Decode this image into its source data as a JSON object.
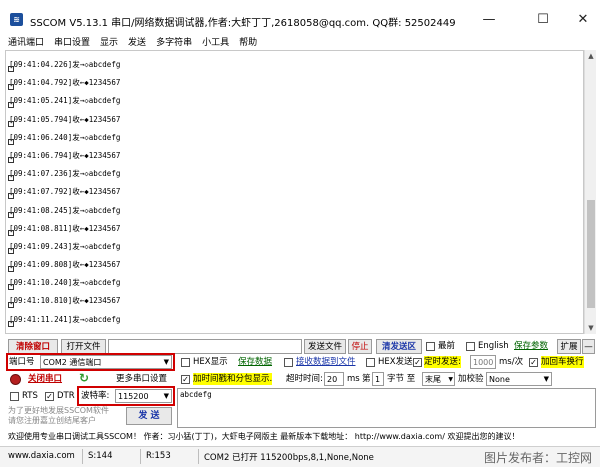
{
  "window": {
    "title": "SSCOM V5.13.1 串口/网络数据调试器,作者:大虾丁丁,2618058@qq.com. QQ群: 52502449",
    "minimize": "—",
    "maximize": "☐",
    "close": "✕"
  },
  "menu": [
    "通讯端口",
    "串口设置",
    "显示",
    "发送",
    "多字符串",
    "小工具",
    "帮助"
  ],
  "log": [
    "[09:41:04.226]发→◇abcdefg",
    "[09:41:04.792]收←◆1234567",
    "[09:41:05.241]发→◇abcdefg",
    "[09:41:05.794]收←◆1234567",
    "[09:41:06.240]发→◇abcdefg",
    "[09:41:06.794]收←◆1234567",
    "[09:41:07.236]发→◇abcdefg",
    "[09:41:07.792]收←◆1234567",
    "[09:41:08.245]发→◇abcdefg",
    "[09:41:08.811]收←◆1234567",
    "[09:41:09.243]发→◇abcdefg",
    "[09:41:09.808]收←◆1234567",
    "[09:41:10.240]发→◇abcdefg",
    "[09:41:10.810]收←◆1234567",
    "[09:41:11.241]发→◇abcdefg"
  ],
  "toolbar": {
    "clear_window": "清除窗口",
    "open_file": "打开文件",
    "send_file": "发送文件",
    "stop": "停止",
    "clear_send": "清发送区",
    "topmost": "最前",
    "english": "English",
    "save_params": "保存参数",
    "expand": "扩展",
    "collapse": "—"
  },
  "port": {
    "label": "端口号",
    "value": "COM2 通信端口",
    "open_port": "关闭串口",
    "more_settings": "更多串口设置",
    "rts": "RTS",
    "dtr": "DTR",
    "baud_label": "波特率:",
    "baud_value": "115200",
    "tip": "为了更好地发展SSCOM软件\n请您注册嘉立创结尾客户",
    "send": "发 送"
  },
  "options": {
    "hex_display": "HEX显示",
    "save_data": "保存数据",
    "recv_to_file": "接收数据到文件",
    "hex_send": "HEX发送",
    "timed_send": "定时发送:",
    "interval": "1000",
    "interval_unit": "ms/次",
    "add_newline": "加回车换行",
    "add_timestamp": "加时间戳和分包显示.",
    "timeout_label": "超时时间:",
    "timeout_value": "20",
    "timeout_unit": "ms",
    "byte_label_pre": "第",
    "byte_value": "1",
    "byte_label_post": "字节 至",
    "end_value": "末尾",
    "checksum_label": "加校验",
    "checksum_value": "None"
  },
  "send_area": {
    "text": "abcdefg"
  },
  "banner": "欢迎使用专业串口调试工具SSCOM！  作者：习小猛(丁丁)，大虾电子网版主  最新版本下载地址： http://www.daxia.com/  欢迎提出您的建议！",
  "status": {
    "site": "www.daxia.com",
    "s": "S:144",
    "r": "R:153",
    "port_state": "COM2 已打开  115200bps,8,1,None,None"
  },
  "watermark": "图片发布者：工控网",
  "colors": {
    "highlight_box": "#d00000",
    "link_green": "#006400",
    "yellow": "#ffff00"
  }
}
